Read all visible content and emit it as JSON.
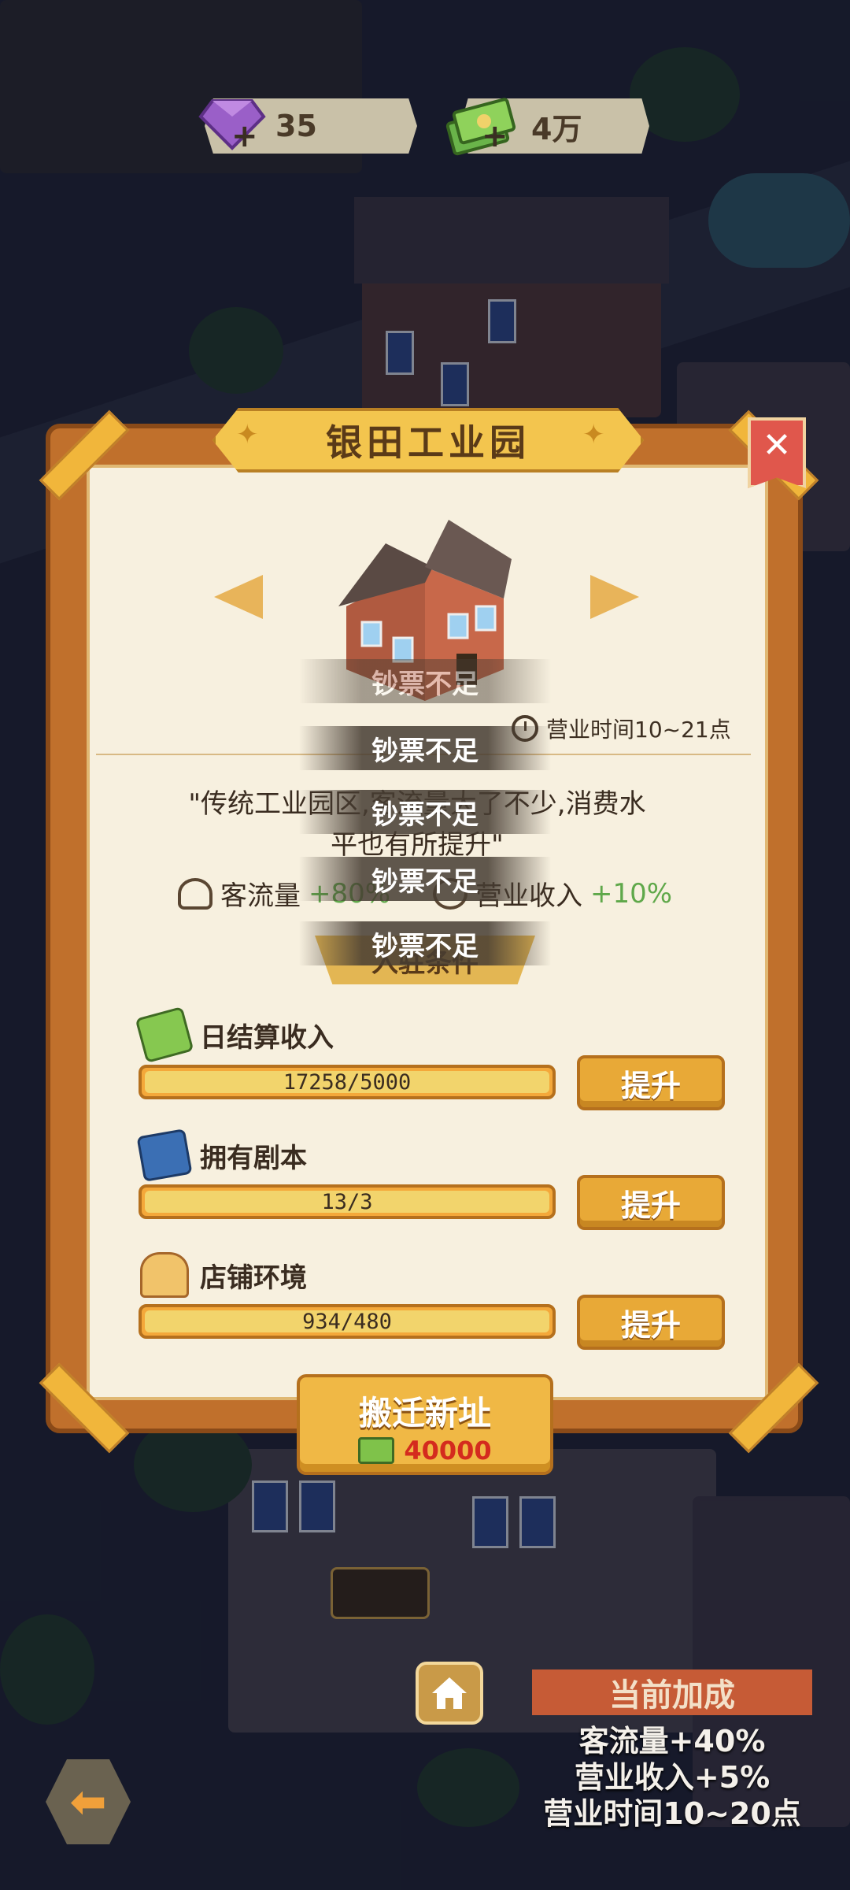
{
  "resources": {
    "gems": "35",
    "cash": "4万"
  },
  "modal": {
    "title": "银田工业园",
    "hours": "营业时间10~21点",
    "description_line1": "\"传统工业园区,客流量大了不少,消费水",
    "description_line2": "平也有所提升\"",
    "stats": [
      {
        "label": "客流量",
        "value": "+80%"
      },
      {
        "label": "营业收入",
        "value": "+10%"
      }
    ],
    "conditions_title": "入驻条件",
    "requirements": [
      {
        "label": "日结算收入",
        "progress": "17258/5000",
        "fill": 1.0,
        "button": "提升"
      },
      {
        "label": "拥有剧本",
        "progress": "13/3",
        "fill": 1.0,
        "button": "提升"
      },
      {
        "label": "店铺环境",
        "progress": "934/480",
        "fill": 1.0,
        "button": "提升"
      }
    ],
    "move_button": {
      "label": "搬迁新址",
      "price": "40000"
    }
  },
  "toasts": [
    "钞票不足",
    "钞票不足",
    "钞票不足",
    "钞票不足",
    "钞票不足"
  ],
  "current_bonus": {
    "title": "当前加成",
    "lines": [
      "客流量+40%",
      "营业收入+5%",
      "营业时间10~20点"
    ]
  },
  "colors": {
    "positive": "#5fa84a",
    "price": "#d42b1e",
    "close": "#e0574c"
  }
}
